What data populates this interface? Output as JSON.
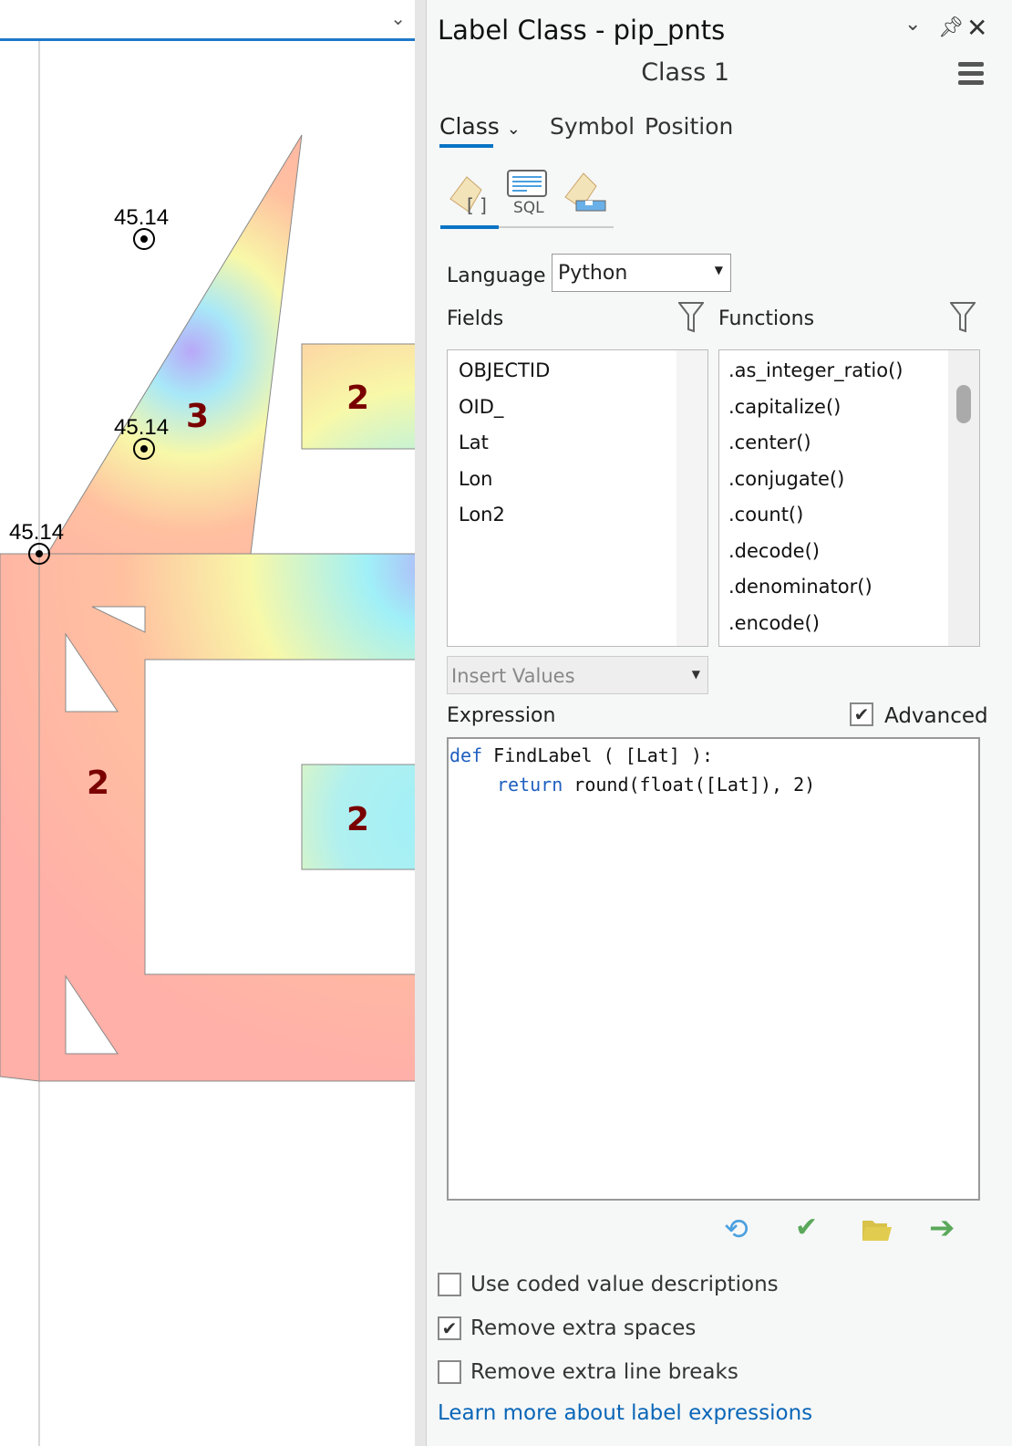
{
  "map": {
    "point_labels": [
      "45.14",
      "45.14",
      "45.14"
    ],
    "polygon_labels": [
      "3",
      "2",
      "2",
      "2"
    ],
    "label_color": "#7a0000"
  },
  "panel": {
    "title": "Label Class - pip_pnts",
    "class_name": "Class 1",
    "tabs": [
      "Class",
      "Symbol",
      "Position"
    ],
    "subtabs": [
      "expression-icon",
      "sql-icon",
      "label-placement-icon"
    ],
    "language_label": "Language",
    "language_value": "Python",
    "fields_label": "Fields",
    "functions_label": "Functions",
    "fields": [
      "OBJECTID",
      "OID_",
      "Lat",
      "Lon",
      "Lon2"
    ],
    "functions": [
      ".as_integer_ratio()",
      ".capitalize()",
      ".center()",
      ".conjugate()",
      ".count()",
      ".decode()",
      ".denominator()",
      ".encode()"
    ],
    "insert_values": "Insert Values",
    "expression_label": "Expression",
    "advanced_label": "Advanced",
    "advanced_checked": true,
    "code": {
      "l1_kw": "def",
      "l1_rest": " FindLabel ( [Lat] ):",
      "l2_kw": "return",
      "l2_rest": " round(float([Lat]), 2)"
    },
    "checkboxes": [
      {
        "label": "Use coded value descriptions",
        "checked": false
      },
      {
        "label": "Remove extra spaces",
        "checked": true
      },
      {
        "label": "Remove extra line breaks",
        "checked": false
      }
    ],
    "link": "Learn more about label expressions",
    "accent": "#0a74c4"
  }
}
